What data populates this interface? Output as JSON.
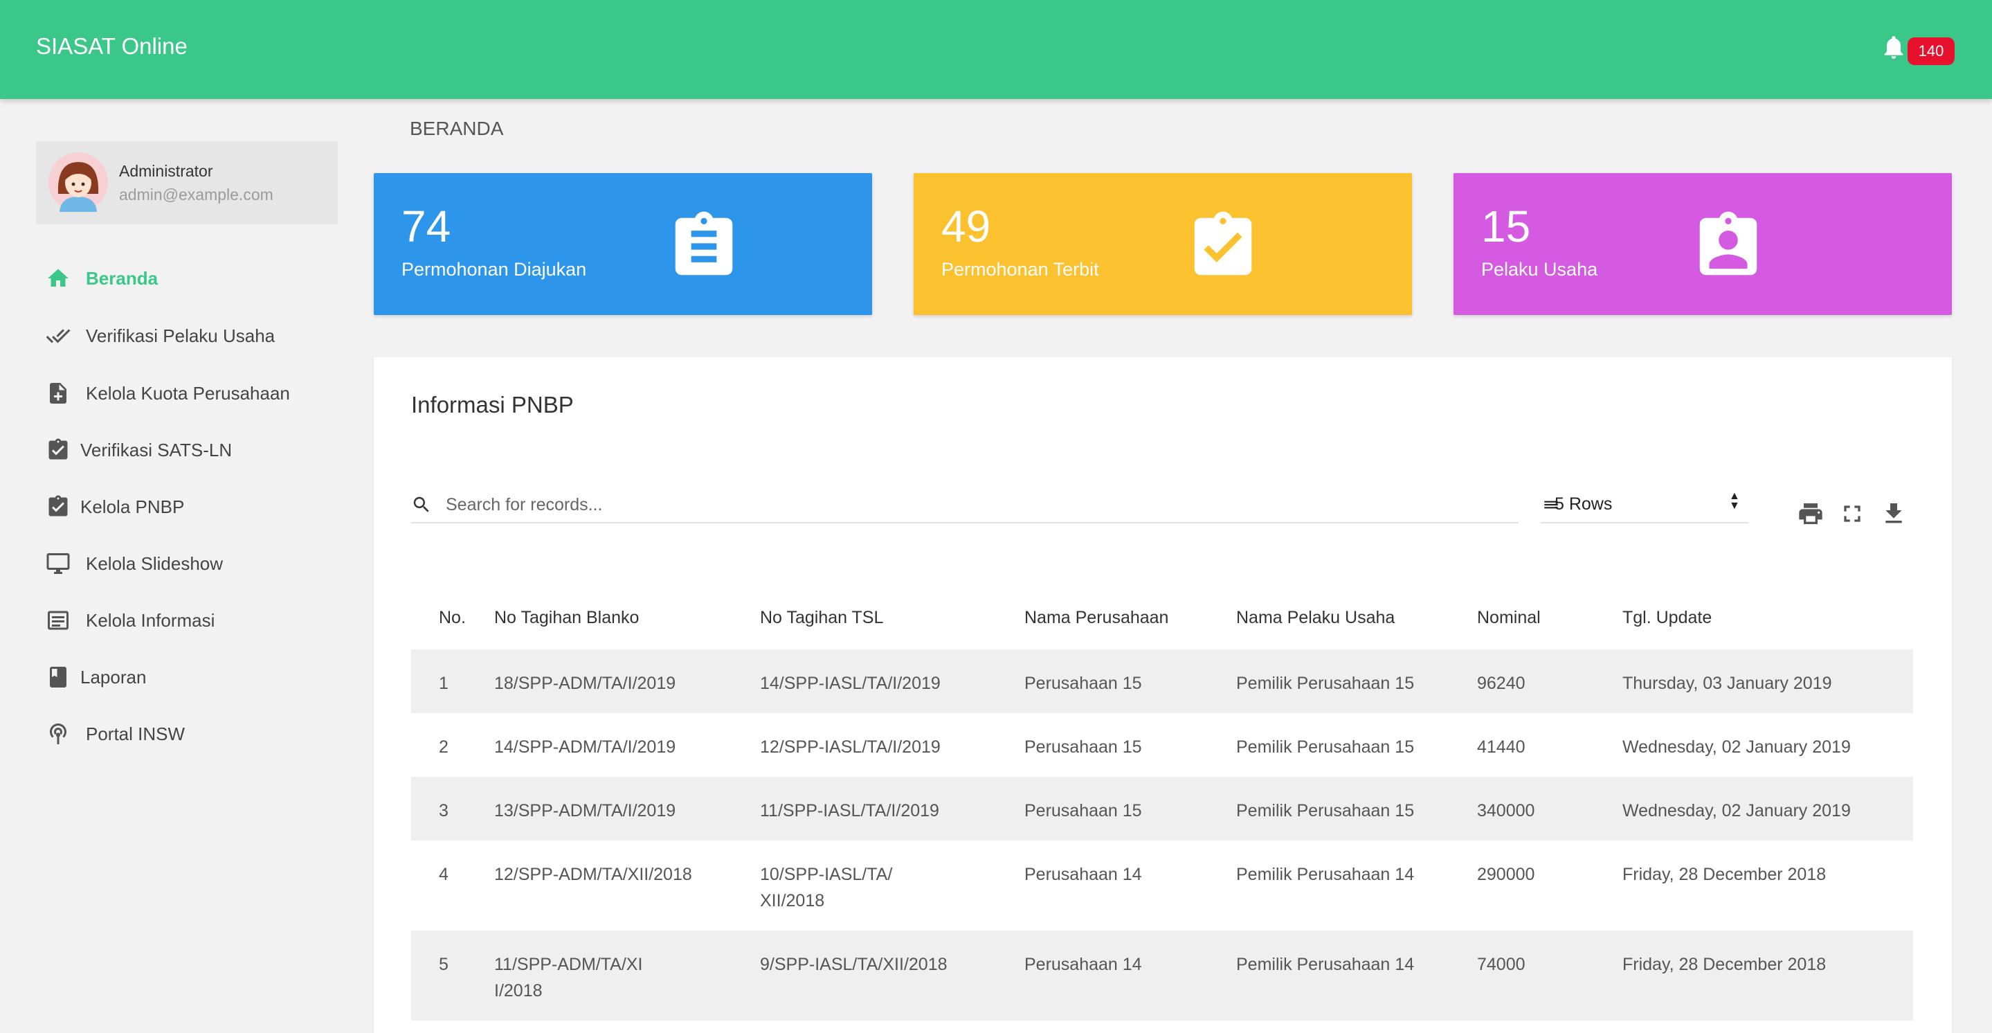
{
  "app": {
    "title": "SIASAT Online",
    "notification_count": "140"
  },
  "user": {
    "name": "Administrator",
    "email": "admin@example.com"
  },
  "sidebar": {
    "items": [
      {
        "label": "Beranda",
        "icon": "home-icon",
        "active": true
      },
      {
        "label": "Verifikasi Pelaku Usaha",
        "icon": "double-check-icon"
      },
      {
        "label": "Kelola Kuota Perusahaan",
        "icon": "file-plus-icon"
      },
      {
        "label": "Verifikasi SATS-LN",
        "icon": "clipboard-check-icon"
      },
      {
        "label": "Kelola PNBP",
        "icon": "clipboard-check-icon"
      },
      {
        "label": "Kelola Slideshow",
        "icon": "monitor-icon"
      },
      {
        "label": "Kelola Informasi",
        "icon": "list-box-icon"
      },
      {
        "label": "Laporan",
        "icon": "book-icon"
      },
      {
        "label": "Portal INSW",
        "icon": "antenna-icon"
      }
    ]
  },
  "page": {
    "title": "BERANDA"
  },
  "stats": [
    {
      "value": "74",
      "label": "Permohonan Diajukan",
      "color": "#2d96eb",
      "icon": "clipboard-list-icon"
    },
    {
      "value": "49",
      "label": "Permohonan Terbit",
      "color": "#fcc12e",
      "icon": "clipboard-check-icon"
    },
    {
      "value": "15",
      "label": "Pelaku Usaha",
      "color": "#d55ae2",
      "icon": "clipboard-account-icon"
    }
  ],
  "panel": {
    "title": "Informasi PNBP",
    "search_placeholder": "Search for records...",
    "rows_select": "5 Rows",
    "columns": [
      "No.",
      "No Tagihan Blanko",
      "No Tagihan TSL",
      "Nama Perusahaan",
      "Nama Pelaku Usaha",
      "Nominal",
      "Tgl. Update"
    ],
    "rows": [
      [
        "1",
        "18/SPP-ADM/TA/I/2019",
        "14/SPP-IASL/TA/I/2019",
        "Perusahaan 15",
        "Pemilik Perusahaan 15",
        "96240",
        "Thursday, 03 January 2019"
      ],
      [
        "2",
        "14/SPP-ADM/TA/I/2019",
        "12/SPP-IASL/TA/I/2019",
        "Perusahaan 15",
        "Pemilik Perusahaan 15",
        "41440",
        "Wednesday, 02 January 2019"
      ],
      [
        "3",
        "13/SPP-ADM/TA/I/2019",
        "11/SPP-IASL/TA/I/2019",
        "Perusahaan 15",
        "Pemilik Perusahaan 15",
        "340000",
        "Wednesday, 02 January 2019"
      ],
      [
        "4",
        "12/SPP-ADM/TA/XII/2018",
        "10/SPP-IASL/TA/XII/2018",
        "Perusahaan 14",
        "Pemilik Perusahaan 14",
        "290000",
        "Friday, 28 December 2018"
      ],
      [
        "5",
        "11/SPP-ADM/TA/XII/2018",
        "9/SPP-IASL/TA/XII/2018",
        "Perusahaan 14",
        "Pemilik Perusahaan 14",
        "74000",
        "Friday, 28 December 2018"
      ]
    ]
  }
}
